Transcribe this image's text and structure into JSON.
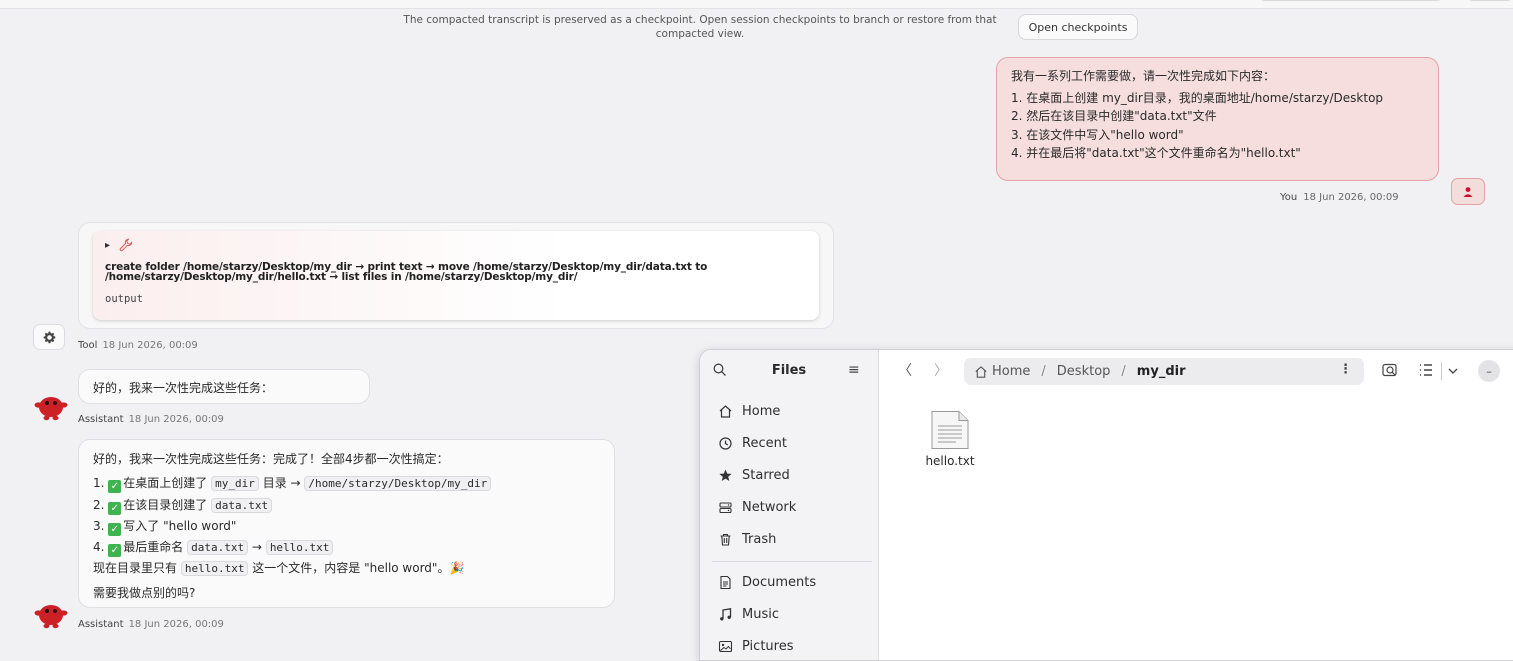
{
  "checkpoint_bar": {
    "note": "The compacted transcript is preserved as a checkpoint. Open session checkpoints to branch or restore from that compacted view.",
    "button": "Open checkpoints"
  },
  "user_message": {
    "intro": "我有一系列工作需要做，请一次性完成如下内容：",
    "items": [
      "1. 在桌面上创建 my_dir目录，我的桌面地址/home/starzy/Desktop",
      "2. 然后在该目录中创建\"data.txt\"文件",
      "3. 在该文件中写入\"hello word\"",
      "4. 并在最后将\"data.txt\"这个文件重命名为\"hello.txt\""
    ],
    "author": "You",
    "time": "18 Jun 2026, 00:09"
  },
  "tool_message": {
    "toggle": "▸",
    "command": "create folder /home/starzy/Desktop/my_dir → print text → move /home/starzy/Desktop/my_dir/data.txt to /home/starzy/Desktop/my_dir/hello.txt → list files in /home/starzy/Desktop/my_dir/",
    "output_label": "output",
    "author": "Tool",
    "time": "18 Jun 2026, 00:09"
  },
  "assistant_message_1": {
    "text": "好的，我来一次性完成这些任务：",
    "author": "Assistant",
    "time": "18 Jun 2026, 00:09"
  },
  "assistant_message_2": {
    "line0": "好的，我来一次性完成这些任务：完成了！全部4步都一次性搞定：",
    "s1_pre": "1. ",
    "s1_text": "在桌面上创建了",
    "s1_code1": "my_dir",
    "s1_mid": "目录 →",
    "s1_code2": "/home/starzy/Desktop/my_dir",
    "s2_pre": "2. ",
    "s2_text": "在该目录创建了",
    "s2_code": "data.txt",
    "s3_pre": "3. ",
    "s3_text": "写入了 \"hello word\"",
    "s4_pre": "4. ",
    "s4_text": "最后重命名",
    "s4_code1": "data.txt",
    "s4_arrow": "→",
    "s4_code2": "hello.txt",
    "summary_pre": "现在目录里只有",
    "summary_code": "hello.txt",
    "summary_post": "这一个文件，内容是 \"hello word\"。🎉",
    "question": "需要我做点别的吗?",
    "author": "Assistant",
    "time": "18 Jun 2026, 00:09"
  },
  "files_app": {
    "title": "Files",
    "sidebar": [
      {
        "label": "Home",
        "icon": "home-icon"
      },
      {
        "label": "Recent",
        "icon": "clock-icon"
      },
      {
        "label": "Starred",
        "icon": "star-icon"
      },
      {
        "label": "Network",
        "icon": "network-icon"
      },
      {
        "label": "Trash",
        "icon": "trash-icon"
      },
      {
        "label": "Documents",
        "icon": "document-icon"
      },
      {
        "label": "Music",
        "icon": "music-icon"
      },
      {
        "label": "Pictures",
        "icon": "picture-icon"
      }
    ],
    "path": [
      "Home",
      "Desktop",
      "my_dir"
    ],
    "path_sep": "/",
    "more": "⋮",
    "files": [
      {
        "name": "hello.txt",
        "icon": "text-file-icon"
      }
    ]
  }
}
